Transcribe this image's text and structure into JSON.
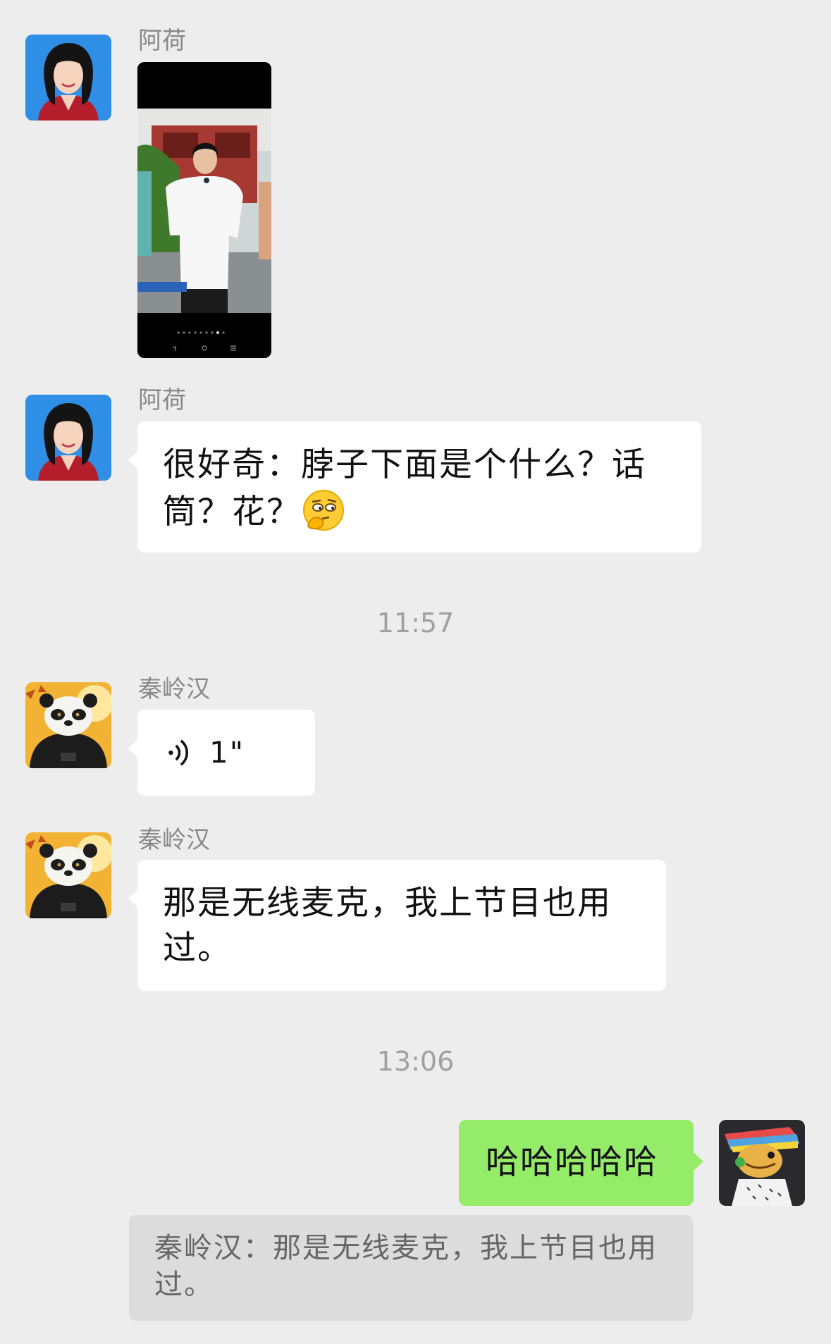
{
  "messages": [
    {
      "sender": "阿荷",
      "type": "image",
      "content_text": ""
    },
    {
      "sender": "阿荷",
      "type": "text",
      "line1": "很好奇：脖子下面是个什么？话",
      "line2": "筒？花？",
      "emoji": "thinking-face-emoji"
    },
    {
      "type": "time",
      "text": "11:57"
    },
    {
      "sender": "秦岭汉",
      "type": "voice",
      "duration": "1\""
    },
    {
      "sender": "秦岭汉",
      "type": "text",
      "line1": "那是无线麦克，我上节目也用",
      "line2": "过。"
    },
    {
      "type": "time",
      "text": "13:06"
    },
    {
      "sender": "me",
      "type": "text",
      "line1": "哈哈哈哈哈"
    }
  ],
  "quote": {
    "line1": "秦岭汉：那是无线麦克，我上节目也用",
    "line2": "过。"
  },
  "colors": {
    "background": "#ededed",
    "bubble_incoming": "#ffffff",
    "bubble_outgoing": "#95ec69",
    "quote_bg": "#dcdcdc"
  }
}
